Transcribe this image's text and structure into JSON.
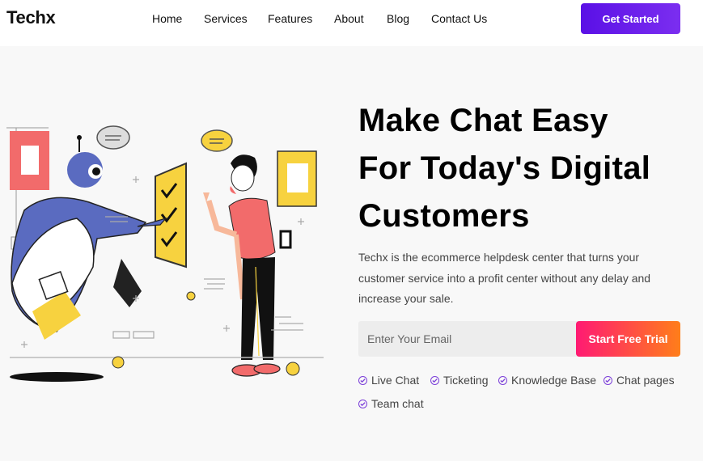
{
  "header": {
    "logo": "Techx",
    "nav": [
      "Home",
      "Services",
      "Features",
      "About",
      "Blog",
      "Contact Us"
    ],
    "cta": "Get Started"
  },
  "hero": {
    "title_lines": [
      "Make Chat Easy",
      "For Today's Digital",
      "Customers"
    ],
    "description": "Techx is the ecommerce helpdesk center that turns your customer service into a profit center without any delay and increase your sale.",
    "email_placeholder": "Enter Your Email",
    "trial_button": "Start Free Trial",
    "features": [
      "Live Chat",
      "Ticketing",
      "Knowledge Base",
      "Chat pages",
      "Team chat"
    ]
  },
  "colors": {
    "primary": "#5a10e6",
    "gradient_start": "#ff1a73",
    "gradient_end": "#ff7e1a",
    "check": "#7b3fd9"
  }
}
